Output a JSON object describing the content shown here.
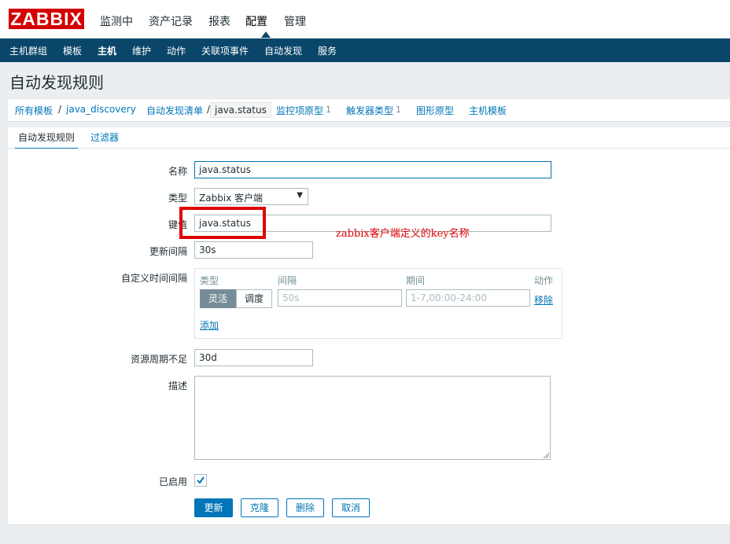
{
  "logo": "ZABBIX",
  "top_menu": [
    "监测中",
    "资产记录",
    "报表",
    "配置",
    "管理"
  ],
  "top_menu_active": "配置",
  "sub_menu": [
    "主机群组",
    "模板",
    "主机",
    "维护",
    "动作",
    "关联项事件",
    "自动发现",
    "服务"
  ],
  "sub_menu_active": "主机",
  "page_title": "自动发现规则",
  "breadcrumbs": {
    "all_templates": "所有模板",
    "sep1": "/",
    "template": "java_discovery",
    "discovery_list": "自动发现清单",
    "sep2": "/",
    "current": "java.status",
    "item_prototypes": "监控项原型",
    "item_prototypes_count": "1",
    "trigger_prototypes": "触发器类型",
    "trigger_prototypes_count": "1",
    "graph_prototypes": "图形原型",
    "host_prototypes": "主机模板"
  },
  "tabs": [
    "自动发现规则",
    "过滤器"
  ],
  "form": {
    "name_label": "名称",
    "name_value": "java.status",
    "type_label": "类型",
    "type_value": "Zabbix 客户端",
    "key_label": "键值",
    "key_value": "java.status",
    "interval_label": "更新间隔",
    "interval_value": "30s",
    "custom_interval_label": "自定义时间间隔",
    "custom_interval": {
      "col_type": "类型",
      "col_interval": "间隔",
      "col_period": "期间",
      "col_action": "动作",
      "flexible": "灵活",
      "scheduling": "调度",
      "interval_placeholder": "50s",
      "period_placeholder": "1-7,00:00-24:00",
      "remove": "移除",
      "add": "添加"
    },
    "lifetime_label": "资源周期不足",
    "lifetime_value": "30d",
    "description_label": "描述",
    "description_value": "",
    "enabled_label": "已启用",
    "enabled": true
  },
  "buttons": [
    "更新",
    "克隆",
    "删除",
    "取消"
  ],
  "annotation": "zabbix客户端定义的key名称",
  "colors": {
    "brand": "#d40000",
    "nav": "#0a466a",
    "link": "#0275b8",
    "annotation": "#e00000"
  }
}
